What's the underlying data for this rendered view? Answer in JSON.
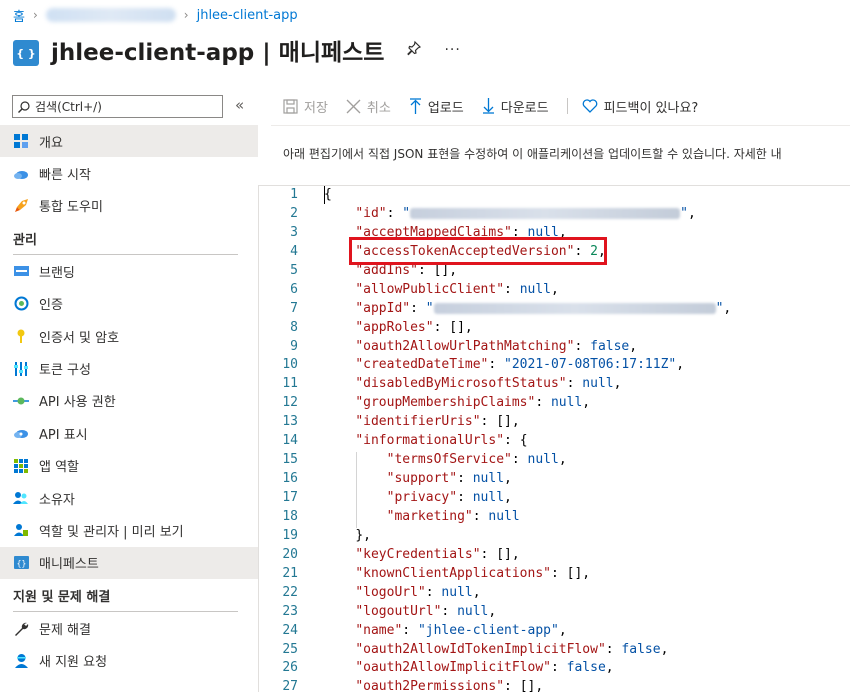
{
  "breadcrumb": {
    "home": "홈",
    "current": "jhlee-client-app"
  },
  "header": {
    "app_icon_text": "{ }",
    "title": "jhlee-client-app | 매니페스트",
    "more": "···"
  },
  "sidebar": {
    "search_placeholder": "검색(Ctrl+/)",
    "collapse": "«",
    "items_top": [
      {
        "label": "개요",
        "icon": "overview-icon",
        "active": true
      },
      {
        "label": "빠른 시작",
        "icon": "quickstart-cloud-icon"
      },
      {
        "label": "통합 도우미",
        "icon": "rocket-icon"
      }
    ],
    "section_manage": "관리",
    "items_manage": [
      {
        "label": "브랜딩",
        "icon": "branding-icon"
      },
      {
        "label": "인증",
        "icon": "authentication-icon"
      },
      {
        "label": "인증서 및 암호",
        "icon": "key-icon"
      },
      {
        "label": "토큰 구성",
        "icon": "token-config-icon"
      },
      {
        "label": "API 사용 권한",
        "icon": "api-permissions-icon"
      },
      {
        "label": "API 표시",
        "icon": "expose-api-icon"
      },
      {
        "label": "앱 역할",
        "icon": "app-roles-icon"
      },
      {
        "label": "소유자",
        "icon": "owners-icon"
      },
      {
        "label": "역할 및 관리자 | 미리 보기",
        "icon": "roles-admins-icon"
      },
      {
        "label": "매니페스트",
        "icon": "manifest-icon",
        "active": true
      }
    ],
    "section_support": "지원 및 문제 해결",
    "items_support": [
      {
        "label": "문제 해결",
        "icon": "wrench-icon"
      },
      {
        "label": "새 지원 요청",
        "icon": "support-request-icon"
      }
    ]
  },
  "toolbar": {
    "save": "저장",
    "discard": "취소",
    "upload": "업로드",
    "download": "다운로드",
    "feedback": "피드백이 있나요?"
  },
  "description": "아래 편집기에서 직접 JSON 표현을 수정하여 이 애플리케이션을 업데이트할 수 있습니다. 자세한 내",
  "editor": {
    "line_numbers": [
      "1",
      "2",
      "3",
      "4",
      "5",
      "6",
      "7",
      "8",
      "9",
      "10",
      "11",
      "12",
      "13",
      "14",
      "15",
      "16",
      "17",
      "18",
      "19",
      "20",
      "21",
      "22",
      "23",
      "24",
      "25",
      "26",
      "27"
    ],
    "lines": {
      "l1": "{",
      "l2k": "\"id\"",
      "l2e": ",",
      "l3k": "\"acceptMappedClaims\"",
      "l3v": "null",
      "l3e": ",",
      "l4k": "\"accessTokenAcceptedVersion\"",
      "l4v": "2",
      "l4e": ",",
      "l5k": "\"addIns\"",
      "l5v": "[]",
      "l5e": ",",
      "l6k": "\"allowPublicClient\"",
      "l6v": "null",
      "l6e": ",",
      "l7k": "\"appId\"",
      "l7e": ",",
      "l8k": "\"appRoles\"",
      "l8v": "[]",
      "l8e": ",",
      "l9k": "\"oauth2AllowUrlPathMatching\"",
      "l9v": "false",
      "l9e": ",",
      "l10k": "\"createdDateTime\"",
      "l10v": "\"2021-07-08T06:17:11Z\"",
      "l10e": ",",
      "l11k": "\"disabledByMicrosoftStatus\"",
      "l11v": "null",
      "l11e": ",",
      "l12k": "\"groupMembershipClaims\"",
      "l12v": "null",
      "l12e": ",",
      "l13k": "\"identifierUris\"",
      "l13v": "[]",
      "l13e": ",",
      "l14k": "\"informationalUrls\"",
      "l14v": "{",
      "l15k": "\"termsOfService\"",
      "l15v": "null",
      "l15e": ",",
      "l16k": "\"support\"",
      "l16v": "null",
      "l16e": ",",
      "l17k": "\"privacy\"",
      "l17v": "null",
      "l17e": ",",
      "l18k": "\"marketing\"",
      "l18v": "null",
      "l19": "},",
      "l20k": "\"keyCredentials\"",
      "l20v": "[]",
      "l20e": ",",
      "l21k": "\"knownClientApplications\"",
      "l21v": "[]",
      "l21e": ",",
      "l22k": "\"logoUrl\"",
      "l22v": "null",
      "l22e": ",",
      "l23k": "\"logoutUrl\"",
      "l23v": "null",
      "l23e": ",",
      "l24k": "\"name\"",
      "l24v": "\"jhlee-client-app\"",
      "l24e": ",",
      "l25k": "\"oauth2AllowIdTokenImplicitFlow\"",
      "l25v": "false",
      "l25e": ",",
      "l26k": "\"oauth2AllowImplicitFlow\"",
      "l26v": "false",
      "l26e": ",",
      "l27k": "\"oauth2Permissions\"",
      "l27v": "[]",
      "l27e": ","
    }
  },
  "colors": {
    "accent": "#0078d4",
    "highlight_border": "#e0141e",
    "json_key": "#a31515",
    "json_value": "#0451a5",
    "json_number": "#098658",
    "line_number": "#237893"
  }
}
